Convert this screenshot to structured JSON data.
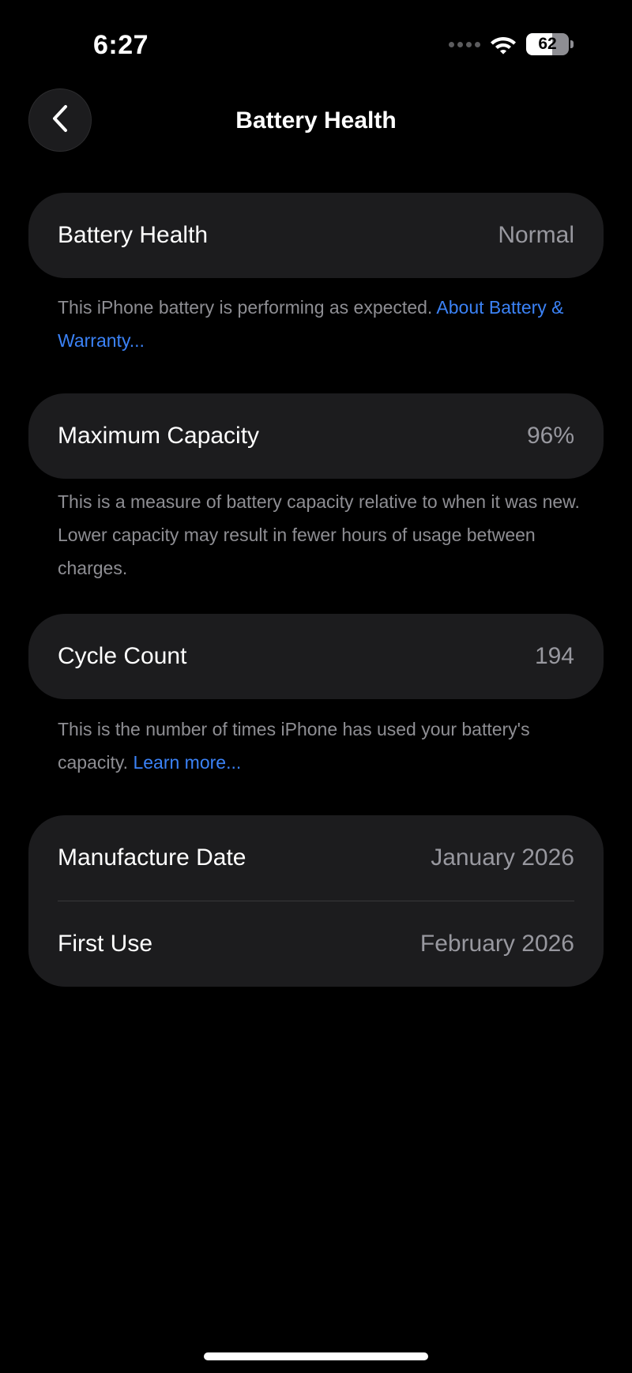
{
  "status_bar": {
    "time": "6:27",
    "battery_level": "62",
    "battery_fraction": 0.62
  },
  "nav": {
    "title": "Battery Health",
    "back_icon": "chevron-left-icon"
  },
  "battery_health": {
    "label": "Battery Health",
    "value": "Normal",
    "footnote": "This iPhone battery is performing as expected.",
    "link": "About Battery & Warranty..."
  },
  "maximum_capacity": {
    "label": "Maximum Capacity",
    "value": "96%",
    "footnote": "This is a measure of battery capacity relative to when it was new. Lower capacity may result in fewer hours of usage between charges."
  },
  "cycle_count": {
    "label": "Cycle Count",
    "value": "194",
    "footnote": "This is the number of times iPhone has used your battery's capacity.",
    "link": "Learn more..."
  },
  "dates": {
    "manufacture_label": "Manufacture Date",
    "manufacture_value": "January 2026",
    "first_use_label": "First Use",
    "first_use_value": "February 2026"
  },
  "colors": {
    "background": "#000000",
    "card": "#1c1c1e",
    "secondary_text": "#8e8e93",
    "link": "#3b82f6"
  }
}
